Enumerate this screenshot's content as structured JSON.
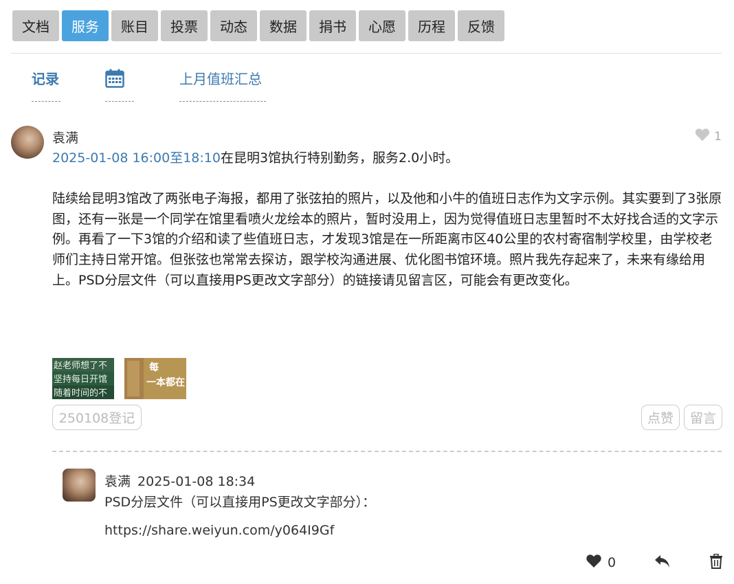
{
  "nav": {
    "items": [
      {
        "label": "文档",
        "active": false
      },
      {
        "label": "服务",
        "active": true
      },
      {
        "label": "账目",
        "active": false
      },
      {
        "label": "投票",
        "active": false
      },
      {
        "label": "动态",
        "active": false
      },
      {
        "label": "数据",
        "active": false
      },
      {
        "label": "捐书",
        "active": false
      },
      {
        "label": "心愿",
        "active": false
      },
      {
        "label": "历程",
        "active": false
      },
      {
        "label": "反馈",
        "active": false
      }
    ]
  },
  "subtabs": {
    "record": "记录",
    "calendar_icon": "calendar-icon",
    "summary": "上月值班汇总"
  },
  "post": {
    "author": "袁满",
    "likes": "1",
    "datetime": "2025-01-08 16:00至18:10",
    "summary": "在昆明3馆执行特别勤务，服务2.0小时。",
    "body": "陆续给昆明3馆改了两张电子海报，都用了张弦拍的照片，以及他和小牛的值班日志作为文字示例。其实要到了3张原图，还有一张是一个同学在馆里看喷火龙绘本的照片，暂时没用上，因为觉得值班日志里暂时不太好找合适的文字示例。再看了一下3馆的介绍和读了些值班日志，才发现3馆是在一所距离市区40公里的农村寄宿制学校里，由学校老师们主持日常开馆。但张弦也常常去探访，跟学校沟通进展、优化图书馆环境。照片我先存起来了，未来有缘给用上。PSD分层文件（可以直接用PS更改文字部分）的链接请见留言区，可能会有更改变化。",
    "thumbs": [
      {
        "text": "赵老师想了不 坚持每日开馆 随着时间的不",
        "color": "#2c5a3e"
      },
      {
        "text": "每一本都在",
        "color": "#b79552"
      }
    ],
    "tag": "250108登记",
    "like_button": "点赞",
    "comment_button": "留言"
  },
  "comment": {
    "author": "袁满",
    "time": "2025-01-08 18:34",
    "text": "PSD分层文件（可以直接用PS更改文字部分）：",
    "link": "https://share.weiyun.com/y064I9Gf",
    "likes": "0"
  },
  "icons": {
    "heart": "heart-icon",
    "reply": "reply-icon",
    "delete": "trash-icon"
  },
  "colors": {
    "accent": "#4aa3de",
    "link": "#3c7ab0",
    "nav_bg": "#c9c9c9"
  }
}
